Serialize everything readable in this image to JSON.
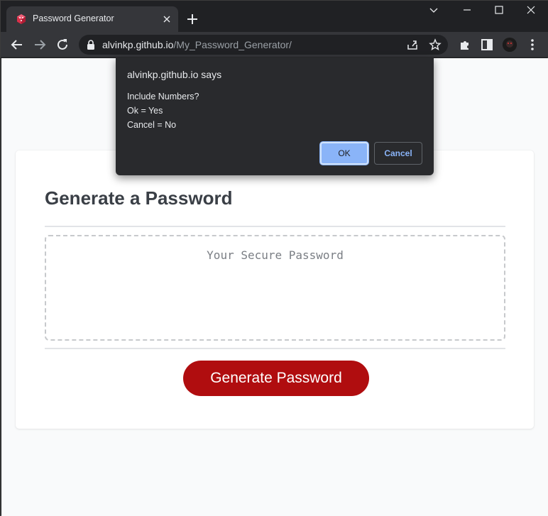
{
  "browser": {
    "tab": {
      "title": "Password Generator",
      "favicon": "red-gem-icon",
      "close_icon": "close-icon"
    },
    "new_tab_icon": "plus-icon",
    "window_controls": [
      "chevron-down-icon",
      "minimize-icon",
      "maximize-icon",
      "close-window-icon"
    ],
    "toolbar": {
      "back_icon": "back-arrow-icon",
      "forward_icon": "forward-arrow-icon",
      "reload_icon": "reload-icon",
      "lock_icon": "lock-icon",
      "url_host": "alvinkp.github.io",
      "url_path": "/My_Password_Generator/",
      "share_icon": "share-icon",
      "bookmark_icon": "star-icon",
      "extensions_icon": "puzzle-icon",
      "sidepanel_icon": "side-panel-icon",
      "avatar": "profile-avatar",
      "menu_icon": "kebab-menu-icon"
    }
  },
  "page": {
    "title": "Generate a Password",
    "password_placeholder": "Your Secure Password",
    "generate_button": "Generate Password",
    "colors": {
      "button": "#b00d0f",
      "background": "#f9fafb",
      "card": "#ffffff"
    }
  },
  "dialog": {
    "title": "alvinkp.github.io says",
    "message": "Include Numbers?\nOk = Yes\nCancel = No",
    "ok_label": "OK",
    "cancel_label": "Cancel",
    "colors": {
      "ok_bg": "#8ab4f8",
      "cancel_text": "#8ab4f8",
      "bg": "#292a2d"
    }
  }
}
